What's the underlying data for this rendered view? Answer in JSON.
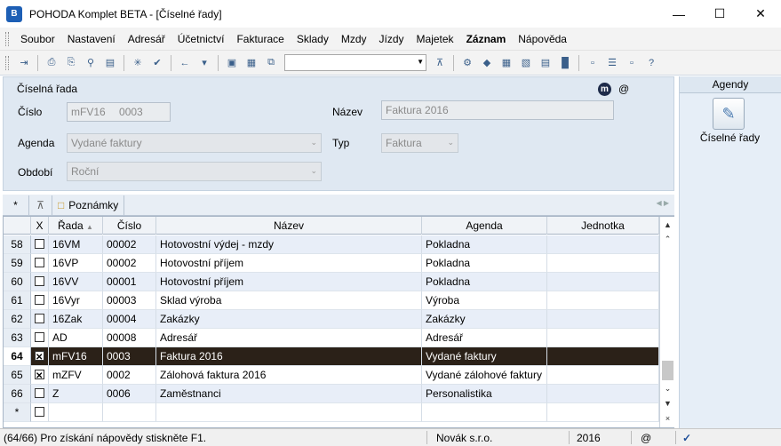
{
  "window": {
    "title": "POHODA Komplet BETA - [Číselné řady]",
    "icon_text": "B"
  },
  "menu": [
    "Soubor",
    "Nastavení",
    "Adresář",
    "Účetnictví",
    "Fakturace",
    "Sklady",
    "Mzdy",
    "Jízdy",
    "Majetek",
    "Záznam",
    "Nápověda"
  ],
  "form": {
    "title": "Číselná řada",
    "cislo_label": "Číslo",
    "cislo_prefix": "mFV16",
    "cislo_value": "0003",
    "nazev_label": "Název",
    "nazev_value": "Faktura 2016",
    "agenda_label": "Agenda",
    "agenda_value": "Vydané faktury",
    "typ_label": "Typ",
    "typ_value": "Faktura",
    "obdobi_label": "Období",
    "obdobi_value": "Roční",
    "m_icon": "m",
    "at_icon": "@"
  },
  "agendy": {
    "header": "Agendy",
    "item_label": "Číselné řady"
  },
  "tabs": {
    "star": "*",
    "notes": "Poznámky"
  },
  "grid": {
    "columns": {
      "x": "X",
      "rada": "Řada",
      "cislo": "Číslo",
      "nazev": "Název",
      "agenda": "Agenda",
      "jednotka": "Jednotka"
    },
    "rows": [
      {
        "n": "58",
        "checked": false,
        "rada": "16VM",
        "cislo": "00002",
        "nazev": "Hotovostní výdej - mzdy",
        "agenda": "Pokladna",
        "jednotka": ""
      },
      {
        "n": "59",
        "checked": false,
        "rada": "16VP",
        "cislo": "00002",
        "nazev": "Hotovostní příjem",
        "agenda": "Pokladna",
        "jednotka": ""
      },
      {
        "n": "60",
        "checked": false,
        "rada": "16VV",
        "cislo": "00001",
        "nazev": "Hotovostní příjem",
        "agenda": "Pokladna",
        "jednotka": ""
      },
      {
        "n": "61",
        "checked": false,
        "rada": "16Vyr",
        "cislo": "00003",
        "nazev": "Sklad výroba",
        "agenda": "Výroba",
        "jednotka": ""
      },
      {
        "n": "62",
        "checked": false,
        "rada": "16Zak",
        "cislo": "00004",
        "nazev": "Zakázky",
        "agenda": "Zakázky",
        "jednotka": ""
      },
      {
        "n": "63",
        "checked": false,
        "rada": "AD",
        "cislo": "00008",
        "nazev": "Adresář",
        "agenda": "Adresář",
        "jednotka": ""
      },
      {
        "n": "64",
        "checked": true,
        "rada": "mFV16",
        "cislo": "0003",
        "nazev": "Faktura 2016",
        "agenda": "Vydané faktury",
        "jednotka": "",
        "selected": true
      },
      {
        "n": "65",
        "checked": true,
        "rada": "mZFV",
        "cislo": "0002",
        "nazev": "Zálohová faktura 2016",
        "agenda": "Vydané zálohové faktury",
        "jednotka": ""
      },
      {
        "n": "66",
        "checked": false,
        "rada": "Z",
        "cislo": "0006",
        "nazev": "Zaměstnanci",
        "agenda": "Personalistika",
        "jednotka": ""
      },
      {
        "n": "*",
        "checked": false,
        "rada": "",
        "cislo": "",
        "nazev": "",
        "agenda": "",
        "jednotka": ""
      }
    ]
  },
  "status": {
    "help": "(64/66) Pro získání nápovědy stiskněte F1.",
    "company": "Novák s.r.o.",
    "year": "2016",
    "at": "@"
  }
}
